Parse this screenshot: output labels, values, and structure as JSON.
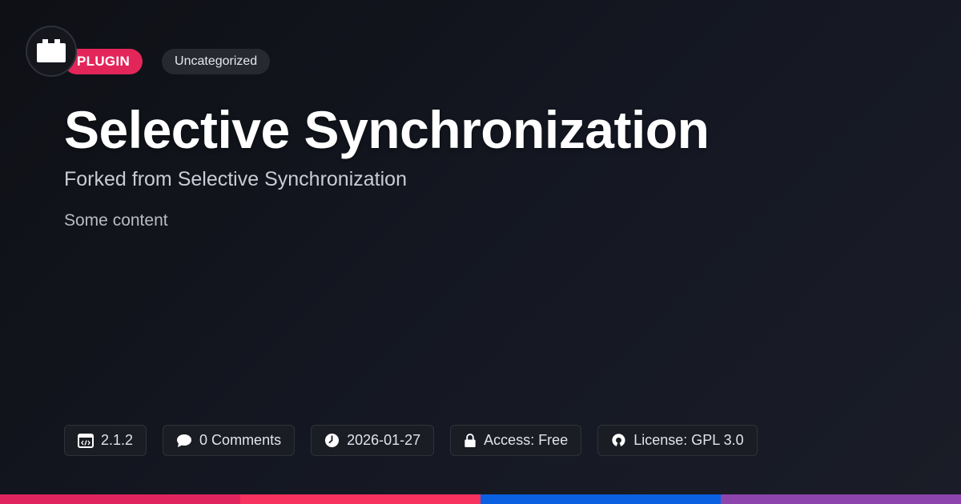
{
  "header": {
    "type_badge": "PLUGIN",
    "category_badge": "Uncategorized",
    "logo_icon": "plugin-block-icon"
  },
  "main": {
    "title": "Selective Synchronization",
    "subtitle": "Forked from Selective Synchronization",
    "content": "Some content"
  },
  "meta": {
    "version": "2.1.2",
    "comments": "0 Comments",
    "date": "2026-01-27",
    "access": "Access: Free",
    "license": "License: GPL 3.0"
  },
  "colors": {
    "accent": "#e3265a",
    "background": "#11131a",
    "bar": [
      "#e0245e",
      "#f7325f",
      "#0a60e0",
      "#8e44ad"
    ]
  }
}
